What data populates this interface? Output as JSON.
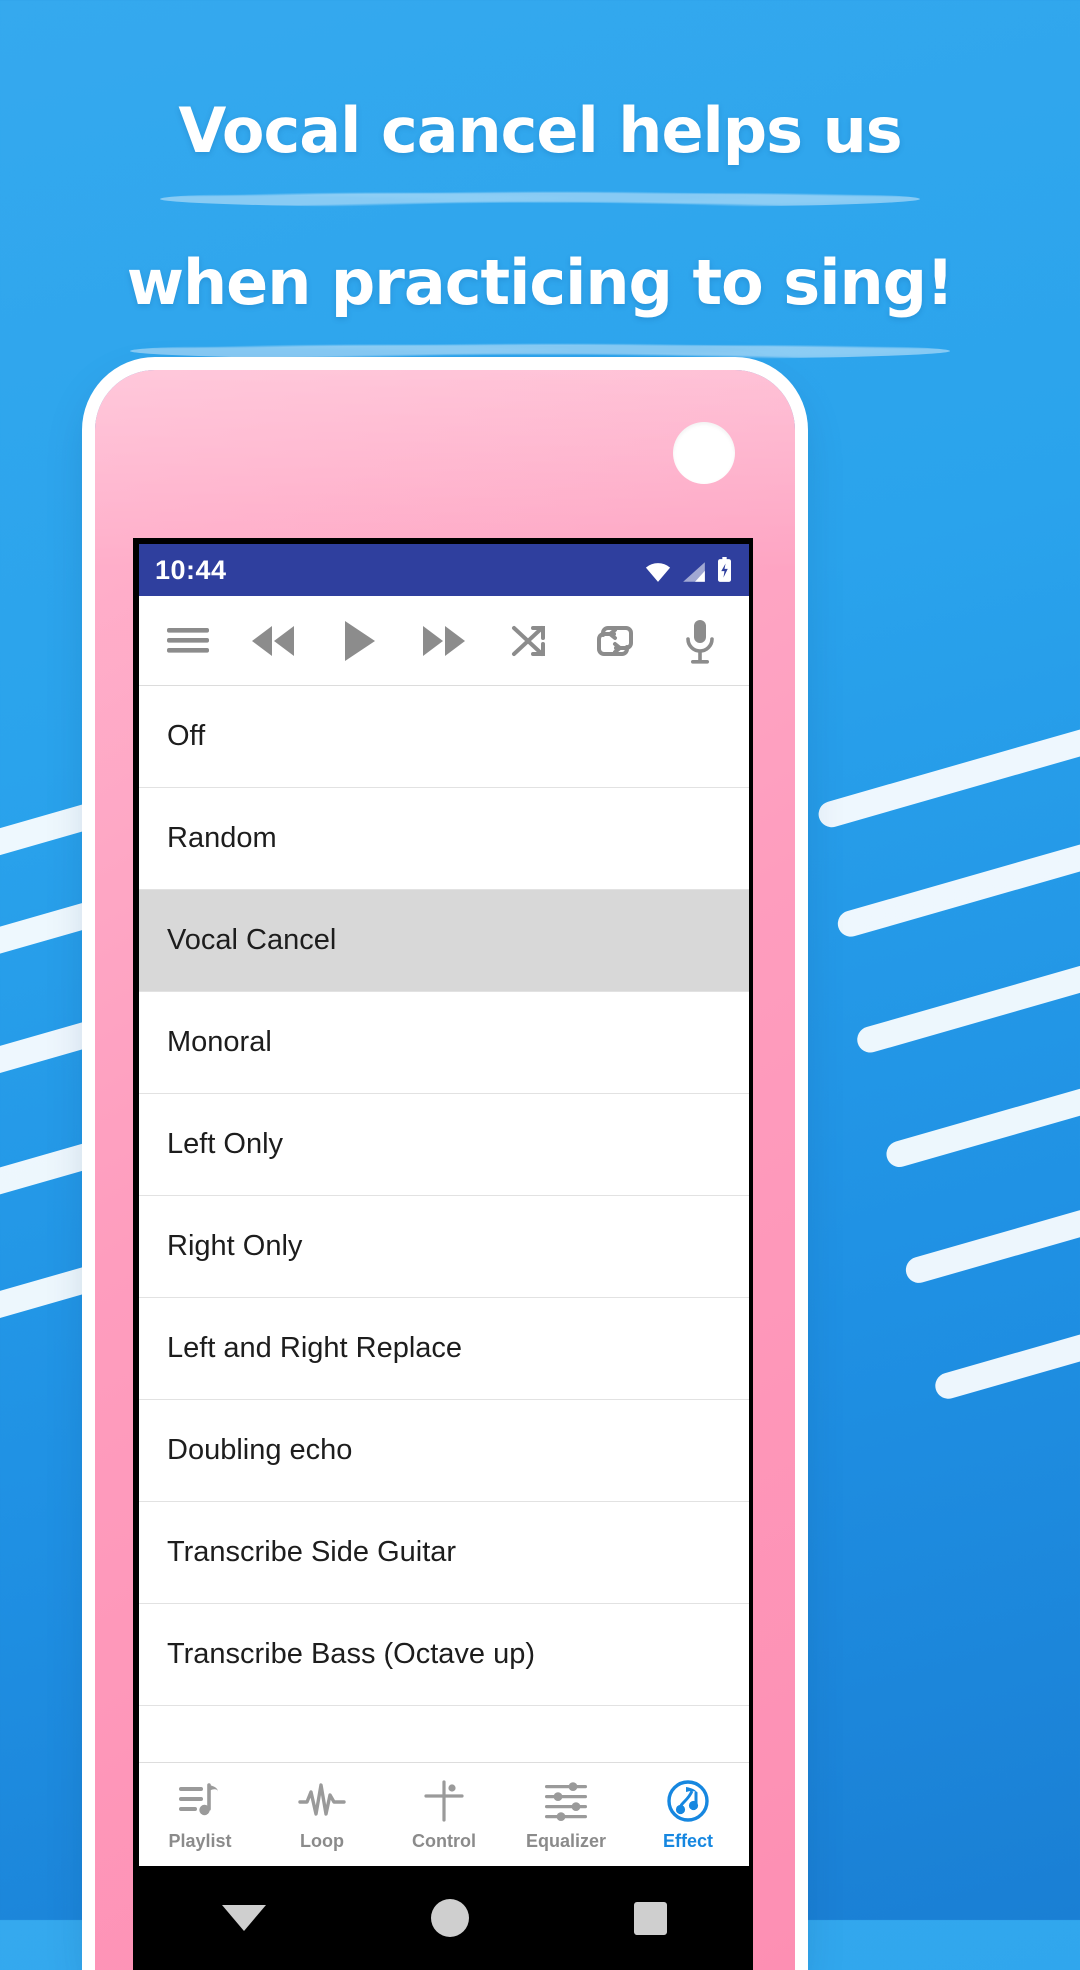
{
  "promo": {
    "headline_line1": "Vocal cancel helps us",
    "headline_line2": "when practicing to sing!",
    "background_color": "#2aa3ec",
    "phone_color": "#fd8fb3"
  },
  "status_bar": {
    "time": "10:44",
    "background_color": "#2f3f9e",
    "icons": [
      "wifi-icon",
      "signal-icon",
      "battery-charging-icon"
    ]
  },
  "toolbar": {
    "buttons": [
      {
        "name": "menu-button",
        "icon": "hamburger-menu-icon"
      },
      {
        "name": "rewind-button",
        "icon": "rewind-icon"
      },
      {
        "name": "play-button",
        "icon": "play-icon"
      },
      {
        "name": "fast-forward-button",
        "icon": "fast-forward-icon"
      },
      {
        "name": "shuffle-button",
        "icon": "shuffle-icon"
      },
      {
        "name": "repeat-button",
        "icon": "repeat-icon"
      },
      {
        "name": "microphone-button",
        "icon": "microphone-icon"
      }
    ],
    "icon_color": "#8c8c8c"
  },
  "effect_list": {
    "selected_index": 2,
    "selected_background": "#d8d8d8",
    "items": [
      {
        "label": "Off"
      },
      {
        "label": "Random"
      },
      {
        "label": "Vocal Cancel"
      },
      {
        "label": "Monoral"
      },
      {
        "label": "Left Only"
      },
      {
        "label": "Right Only"
      },
      {
        "label": "Left and Right Replace"
      },
      {
        "label": "Doubling echo"
      },
      {
        "label": "Transcribe Side Guitar"
      },
      {
        "label": "Transcribe Bass (Octave up)"
      }
    ]
  },
  "tab_bar": {
    "active_index": 4,
    "active_color": "#1687e0",
    "inactive_color": "#8b8b8b",
    "tabs": [
      {
        "label": "Playlist",
        "icon": "playlist-note-icon"
      },
      {
        "label": "Loop",
        "icon": "waveform-icon"
      },
      {
        "label": "Control",
        "icon": "control-cross-icon"
      },
      {
        "label": "Equalizer",
        "icon": "equalizer-sliders-icon"
      },
      {
        "label": "Effect",
        "icon": "effect-circle-note-icon"
      }
    ]
  },
  "nav_bar": {
    "buttons": [
      {
        "name": "back-button",
        "icon": "triangle-back-icon"
      },
      {
        "name": "home-button",
        "icon": "circle-home-icon"
      },
      {
        "name": "recent-button",
        "icon": "square-recent-icon"
      }
    ]
  }
}
